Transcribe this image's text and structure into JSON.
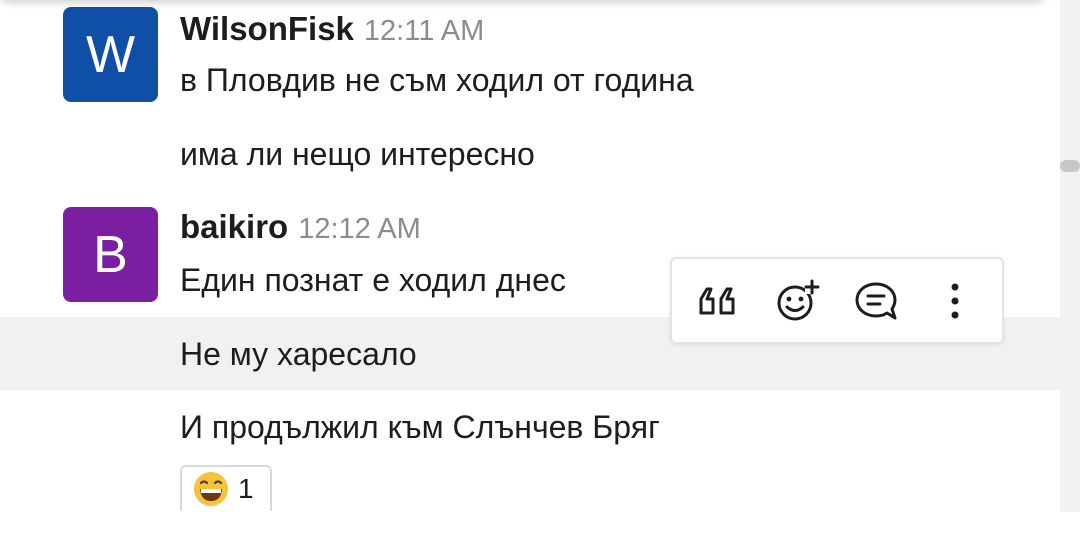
{
  "messages": [
    {
      "author": "WilsonFisk",
      "time": "12:11 AM",
      "avatar_letter": "W",
      "avatar_color": "#0f4fa8",
      "lines": [
        "в Пловдив не съм ходил от година",
        "има ли нещо интересно"
      ]
    },
    {
      "author": "baikiro",
      "time": "12:12 AM",
      "avatar_letter": "B",
      "avatar_color": "#7a1fa2",
      "lines": [
        "Един познат е ходил днес",
        "Не му харесало",
        "И продължил към Слънчев Бряг"
      ]
    }
  ],
  "reaction": {
    "emoji": "😄",
    "count": "1"
  },
  "toolbar": {
    "icons": [
      "quote-icon",
      "add-reaction-icon",
      "reply-in-thread-icon",
      "more-options-icon"
    ]
  },
  "colors": {
    "hover_row": "#f1f1f1",
    "icon": "#1d1d1d",
    "time": "#8c8c8c"
  }
}
